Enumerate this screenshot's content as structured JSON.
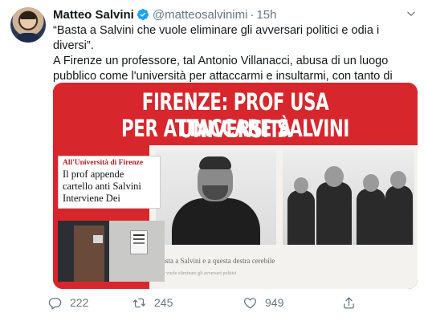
{
  "tweet": {
    "author_name": "Matteo Salvini",
    "author_handle": "@matteosalvinimi",
    "separator": "·",
    "time": "15h",
    "text": "“Basta a Salvini che vuole eliminare gli avversari politici e odia i diversi”.\nA Firenze un professore, tal Antonio Villanacci, abusa di un luogo pubblico come l'università per attaccarmi e insultarmi, con tanto di manifesto, usando il suo ufficio come bacheca politica."
  },
  "media": {
    "headline_line1": "FIRENZE: PROF USA UNIVERSITÀ",
    "headline_line2": "PER ATTACCARE SALVINI",
    "box_kicker": "All'Università di Firenze",
    "box_body": "Il prof appende\ncartello anti Salvini\nInterviene Dei",
    "poster_caption": "Basta a Salvini e a questa destra cerebile",
    "poster_subcaption": "Che vuole eliminare gli avversari politici"
  },
  "actions": {
    "replies": "222",
    "retweets": "245",
    "likes": "949"
  },
  "colors": {
    "accent": "#1da1f2",
    "text": "#14171a",
    "muted": "#657786",
    "media_red": "#d8262d"
  },
  "icons": [
    "verified-badge-icon",
    "chevron-down-icon",
    "reply-icon",
    "retweet-icon",
    "like-icon",
    "share-icon"
  ]
}
